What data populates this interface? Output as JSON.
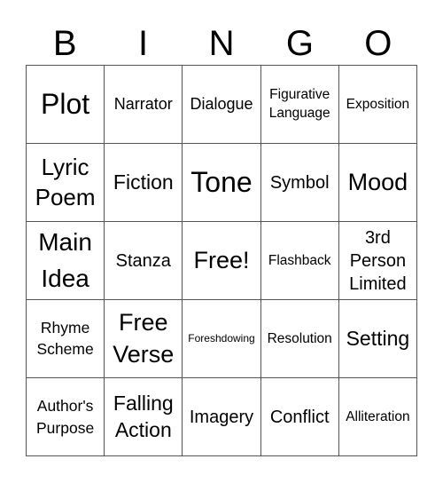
{
  "header": [
    "B",
    "I",
    "N",
    "G",
    "O"
  ],
  "cells": [
    [
      "Plot",
      "Narrator",
      "Dialogue",
      "Figurative Language",
      "Exposition"
    ],
    [
      "Lyric Poem",
      "Fiction",
      "Tone",
      "Symbol",
      "Mood"
    ],
    [
      "Main Idea",
      "Stanza",
      "Free!",
      "Flashback",
      "3rd Person Limited"
    ],
    [
      "Rhyme Scheme",
      "Free Verse",
      "Foreshdowing",
      "Resolution",
      "Setting"
    ],
    [
      "Author's Purpose",
      "Falling Action",
      "Imagery",
      "Conflict",
      "Alliteration"
    ]
  ]
}
